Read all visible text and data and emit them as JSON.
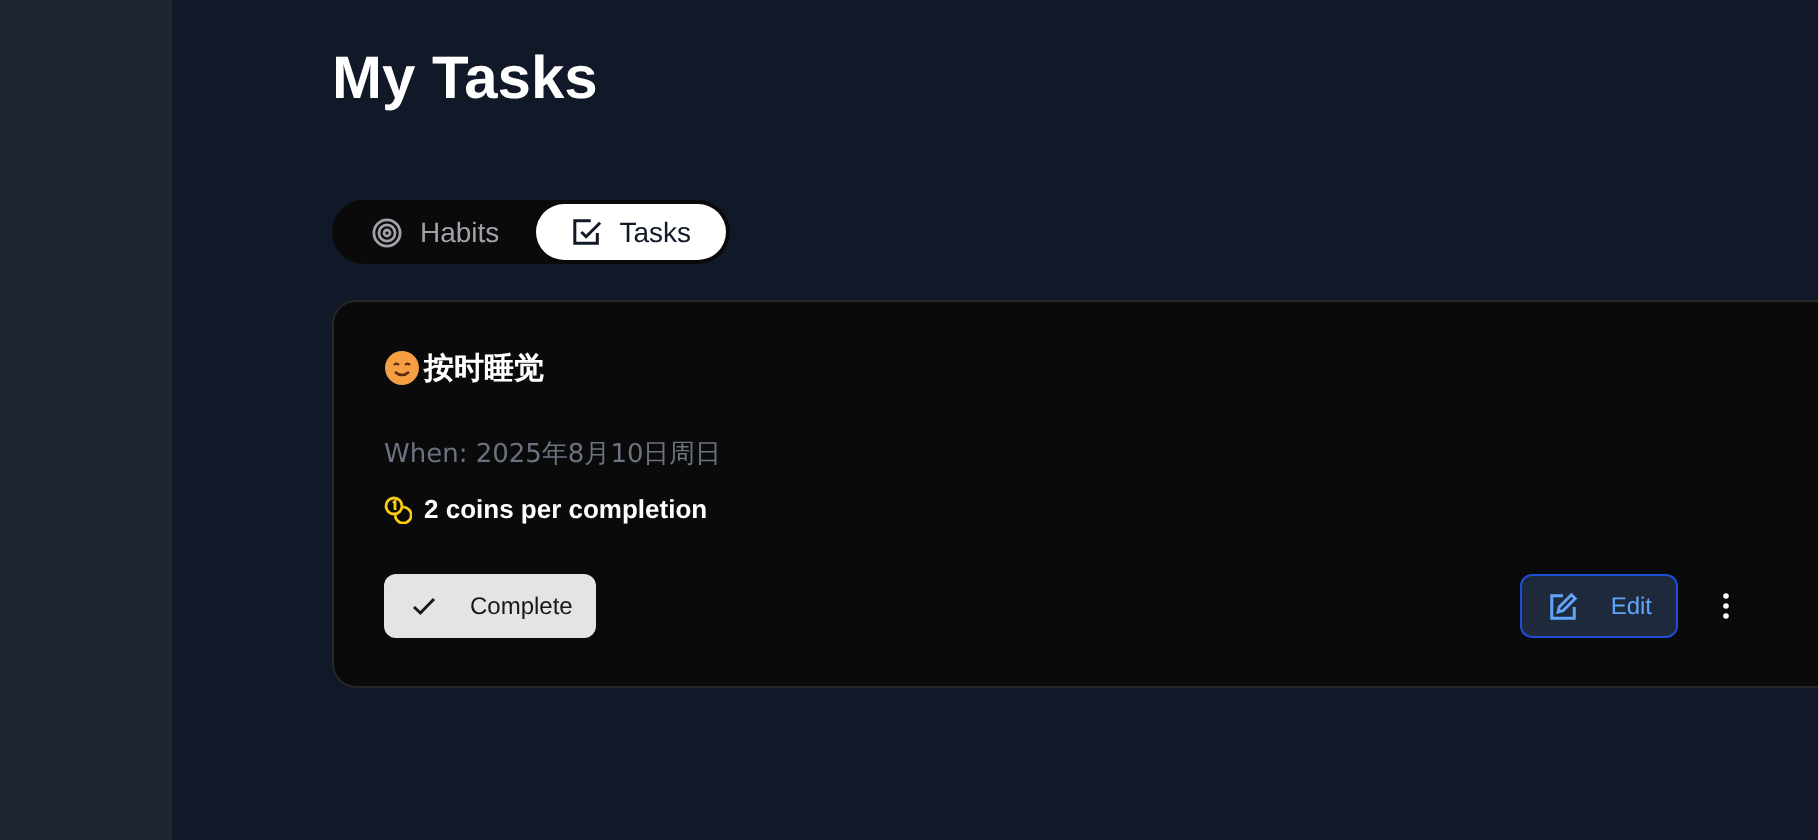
{
  "page": {
    "title": "My Tasks"
  },
  "tabs": [
    {
      "label": "Habits",
      "kind": "habits",
      "selected": false
    },
    {
      "label": "Tasks",
      "kind": "tasks",
      "selected": true
    }
  ],
  "task": {
    "title": "按时睡觉",
    "when": "When: 2025年8月10日周日",
    "reward": "2 coins per completion",
    "buttons": [
      {
        "label": "Complete",
        "kind": "complete"
      },
      {
        "label": "Edit",
        "kind": "edit"
      }
    ]
  }
}
